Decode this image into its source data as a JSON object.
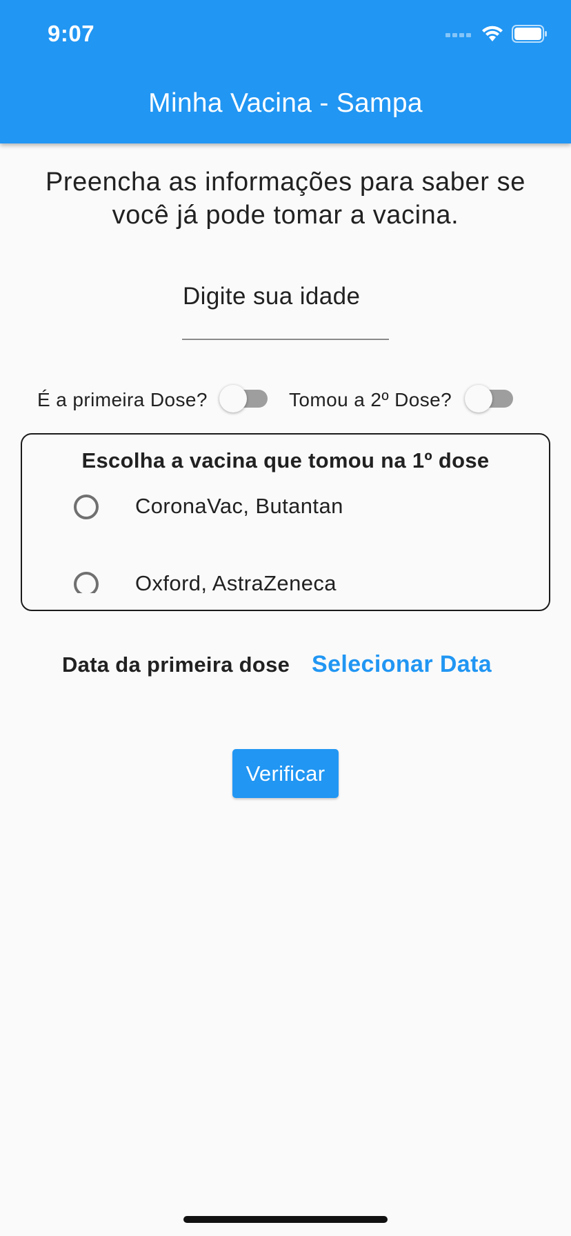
{
  "status_bar": {
    "time": "9:07",
    "icons": [
      "signal-icon",
      "wifi-icon",
      "battery-icon"
    ]
  },
  "app_bar": {
    "title": "Minha Vacina - Sampa",
    "color": "#2196f3"
  },
  "intro_text": "Preencha as informações para saber se você já pode tomar a vacina.",
  "age_input": {
    "placeholder": "Digite sua idade",
    "value": ""
  },
  "toggles": {
    "first_dose": {
      "label": "É a primeira Dose?",
      "on": false
    },
    "second_dose": {
      "label": "Tomou a 2º Dose?",
      "on": false
    }
  },
  "vaccine_selector": {
    "title": "Escolha a vacina que tomou na 1º dose",
    "options": [
      {
        "label": "CoronaVac, Butantan",
        "selected": false
      },
      {
        "label": "Oxford, AstraZeneca",
        "selected": false
      }
    ]
  },
  "first_dose_date": {
    "label": "Data da primeira dose",
    "action": "Selecionar Data"
  },
  "verify_button": {
    "label": "Verificar"
  }
}
